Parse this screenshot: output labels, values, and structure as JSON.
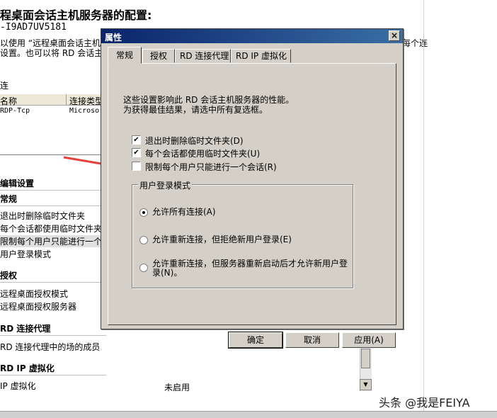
{
  "background": {
    "title": "程桌面会话主机服务器的配置:",
    "server_name": "-I9AD7UV5181",
    "description_line1": "以使用 “远程桌面会话主机",
    "description_line1_right": "每个连",
    "description_line2": "设置。也可以将 RD 会话主",
    "connections_label": "连",
    "table": {
      "col_name": "名称",
      "col_type": "连接类型",
      "row_name": "RDP-Tcp",
      "row_type": "Microso"
    },
    "edit_settings_title": "编辑设置",
    "sections": [
      {
        "title": "常规",
        "items": [
          "退出时删除临时文件夹",
          "每个会话都使用临时文件夹",
          "限制每个用户只能进行一个",
          "用户登录模式"
        ]
      },
      {
        "title": "授权",
        "items": [
          "远程桌面授权模式",
          "远程桌面授权服务器"
        ]
      },
      {
        "title": "RD 连接代理",
        "items": [
          "RD 连接代理中的场的成员"
        ]
      },
      {
        "title": "RD IP 虚拟化",
        "items": [
          "IP 虚拟化"
        ]
      }
    ],
    "ip_virtualization_value": "未启用"
  },
  "dialog": {
    "title": "属性",
    "close_label": "×",
    "tabs": [
      "常规",
      "授权",
      "RD 连接代理",
      "RD IP 虚拟化"
    ],
    "active_tab": "常规",
    "intro_line1": "这些设置影响此 RD 会话主机服务器的性能。",
    "intro_line2": "为获得最佳结果，请选中所有复选框。",
    "checkboxes": [
      {
        "label": "退出时删除临时文件夹(D)",
        "checked": true
      },
      {
        "label": "每个会话都使用临时文件夹(U)",
        "checked": true
      },
      {
        "label": "限制每个用户只能进行一个会话(R)",
        "checked": false
      }
    ],
    "logon_group": {
      "title": "用户登录模式",
      "options": [
        {
          "label": "允许所有连接(A)",
          "selected": true
        },
        {
          "label": "允许重新连接，但拒绝新用户登录(E)",
          "selected": false
        },
        {
          "label_line1": "允许重新连接，但服务器重新启动后才允许新用户登",
          "label_line2": "录(N)。",
          "selected": false
        }
      ]
    },
    "buttons": {
      "ok": "确定",
      "cancel": "取消",
      "apply": "应用(A)"
    }
  },
  "watermark": "头条 @我是FEIYA",
  "colors": {
    "titlebar": "#0a246a",
    "dialog_face": "#d4d0c8",
    "arrow": "#e8403a"
  }
}
